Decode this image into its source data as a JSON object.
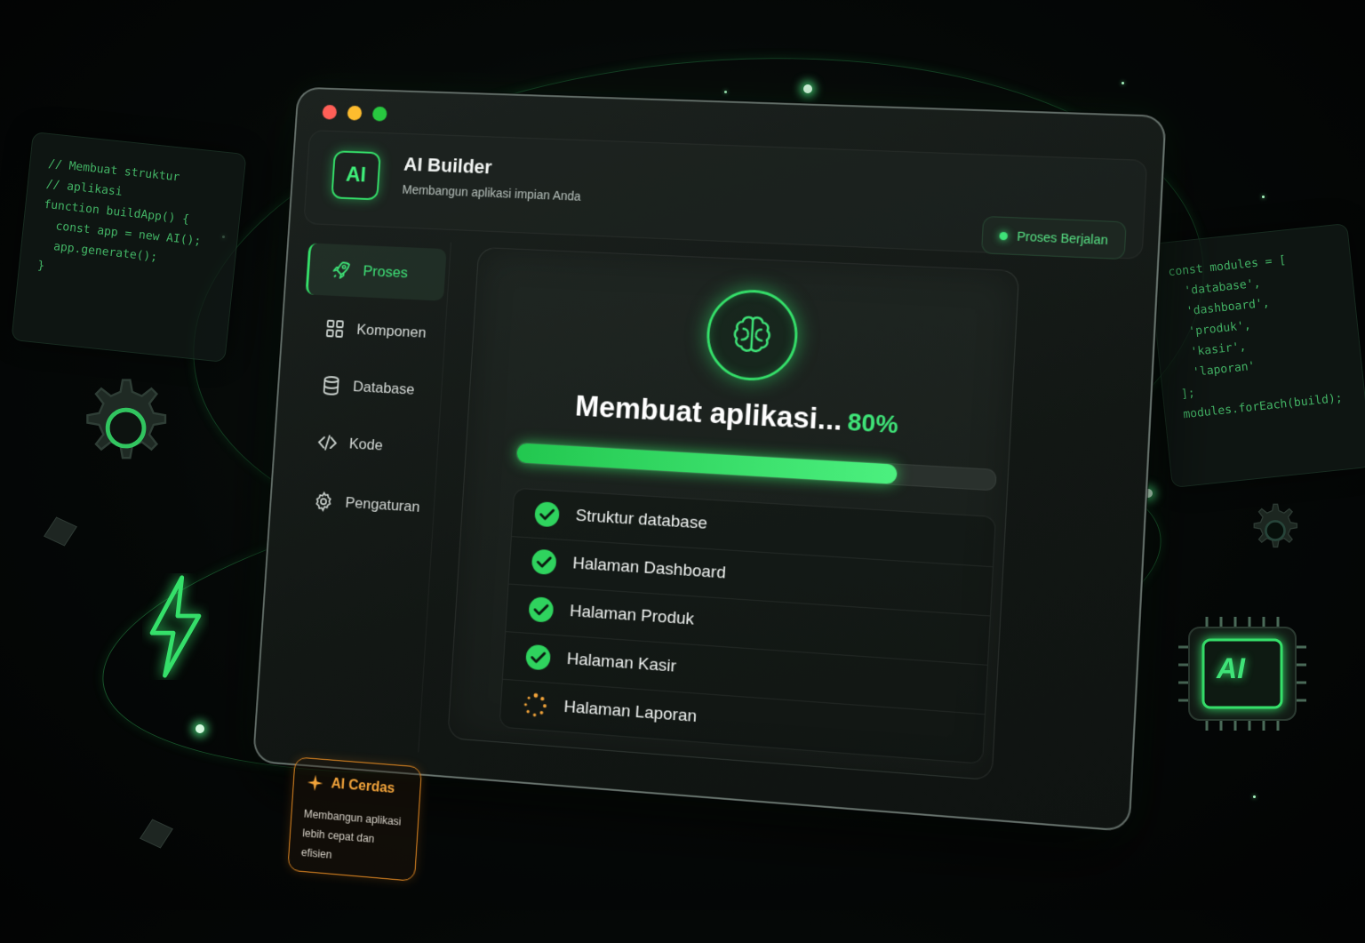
{
  "app": {
    "logo": "AI",
    "title": "AI Builder",
    "subtitle": "Membangun aplikasi impian Anda",
    "status": "Proses Berjalan"
  },
  "sidebar": {
    "items": [
      {
        "label": "Proses",
        "icon": "rocket-icon",
        "active": true
      },
      {
        "label": "Komponen",
        "icon": "grid-icon",
        "active": false
      },
      {
        "label": "Database",
        "icon": "database-icon",
        "active": false
      },
      {
        "label": "Kode",
        "icon": "code-icon",
        "active": false
      },
      {
        "label": "Pengaturan",
        "icon": "gear-icon",
        "active": false
      }
    ],
    "promo": {
      "title": "AI Cerdas",
      "text": "Membangun aplikasi lebih cepat dan efisien"
    }
  },
  "progress": {
    "title": "Membuat aplikasi...",
    "percent_label": "80%",
    "value": 0.8
  },
  "tasks": [
    {
      "label": "Struktur database",
      "status": "done"
    },
    {
      "label": "Halaman Dashboard",
      "status": "done"
    },
    {
      "label": "Halaman Produk",
      "status": "done"
    },
    {
      "label": "Halaman Kasir",
      "status": "done"
    },
    {
      "label": "Halaman Laporan",
      "status": "loading"
    }
  ],
  "code_left": "// Membuat struktur\n// aplikasi\nfunction buildApp() {\n  const app = new AI();\n  app.generate();\n}",
  "code_right": "const modules = [\n  'database',\n  'dashboard',\n  'produk',\n  'kasir',\n  'laporan'\n];\nmodules.forEach(build);",
  "chip_label": "AI",
  "colors": {
    "accent": "#3fe478",
    "promo_accent": "#f3a43a",
    "background": "#050807"
  }
}
